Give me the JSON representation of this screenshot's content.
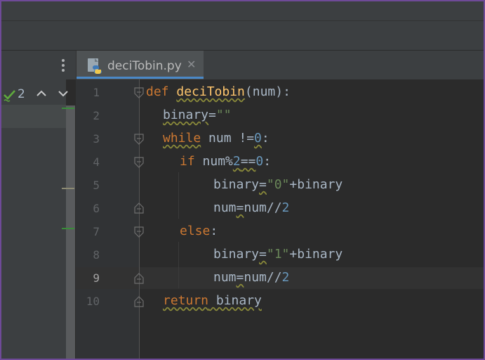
{
  "tab": {
    "filename": "deciTobin.py",
    "close_glyph": "✕"
  },
  "inspections": {
    "count": "2"
  },
  "gutter": {
    "line_numbers": [
      "1",
      "2",
      "3",
      "4",
      "5",
      "6",
      "7",
      "8",
      "9",
      "10"
    ]
  },
  "code": {
    "l1": {
      "kw": "def",
      "name": "deciTobin",
      "rest": "(num):"
    },
    "l2": {
      "ident": "binary",
      "op": "=",
      "str": "\"\""
    },
    "l3": {
      "kw": "while",
      "a": " num !=",
      "num": "0",
      "b": ":"
    },
    "l4": {
      "kw": "if",
      "a": " num%",
      "n1": "2",
      "op": "==",
      "n2": "0",
      "b": ":"
    },
    "l5": {
      "ident": "binary",
      "op": "=",
      "str": "\"0\"",
      "rest": "+binary"
    },
    "l6": {
      "a": "num",
      "op": "=",
      "b": "num//",
      "num": "2"
    },
    "l7": {
      "kw": "else",
      "b": ":"
    },
    "l8": {
      "ident": "binary",
      "op": "=",
      "str": "\"1\"",
      "rest": "+binary"
    },
    "l9": {
      "a": "num",
      "op": "=",
      "b": "num//",
      "num": "2"
    },
    "l10": {
      "kw": "return",
      "rest": " binary"
    }
  },
  "colors": {
    "keyword": "#cc7832",
    "function": "#ffc66d",
    "string": "#6a8759",
    "number": "#6897bb",
    "text": "#a9b7c6",
    "background": "#2b2b2b"
  },
  "icons": [
    "kebab-menu-icon",
    "python-file-icon",
    "close-icon",
    "inspection-ok-icon",
    "chevron-up-icon",
    "chevron-down-icon",
    "fold-icon"
  ]
}
